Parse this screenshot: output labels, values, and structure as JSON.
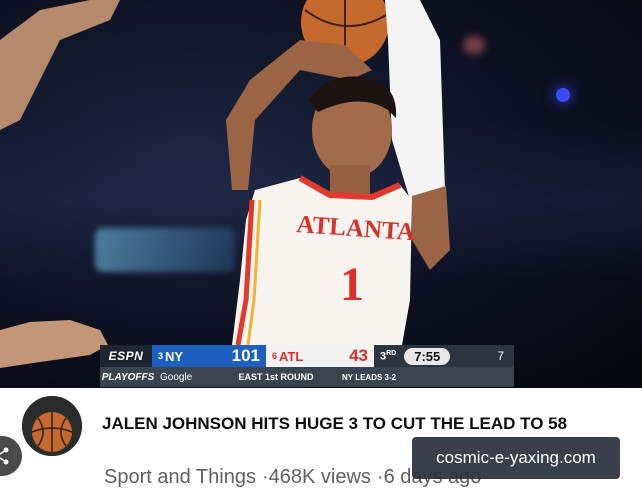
{
  "scoreboard": {
    "network": "ESPN",
    "away": {
      "seed": "3",
      "team": "NY",
      "score": "101"
    },
    "home": {
      "seed": "6",
      "team": "ATL",
      "score": "43"
    },
    "period": "3",
    "period_suffix": "RD",
    "clock": "7:55",
    "shot_clock": "7",
    "playoffs_label": "PLAYOFFS",
    "sponsor": "Google",
    "round": "EAST 1st ROUND",
    "series": "NY LEADS 3-2"
  },
  "jersey": {
    "wordmark": "ATLANTA",
    "number": "1"
  },
  "video": {
    "title": "JALEN JOHNSON HITS HUGE 3 TO CUT THE LEAD TO 58",
    "channel": "Sport and Things",
    "views": "468K views",
    "age": "6 days ago",
    "separator": "·"
  },
  "watermark": {
    "text": "cosmic-e-yaxing.com"
  },
  "colors": {
    "ny_blue": "#1c5fbf",
    "atl_red": "#e02a2a",
    "title_text": "#0f0f0f",
    "subtitle_text": "#606060"
  },
  "icons": {
    "share": "share-icon",
    "avatar": "basketball-icon"
  }
}
